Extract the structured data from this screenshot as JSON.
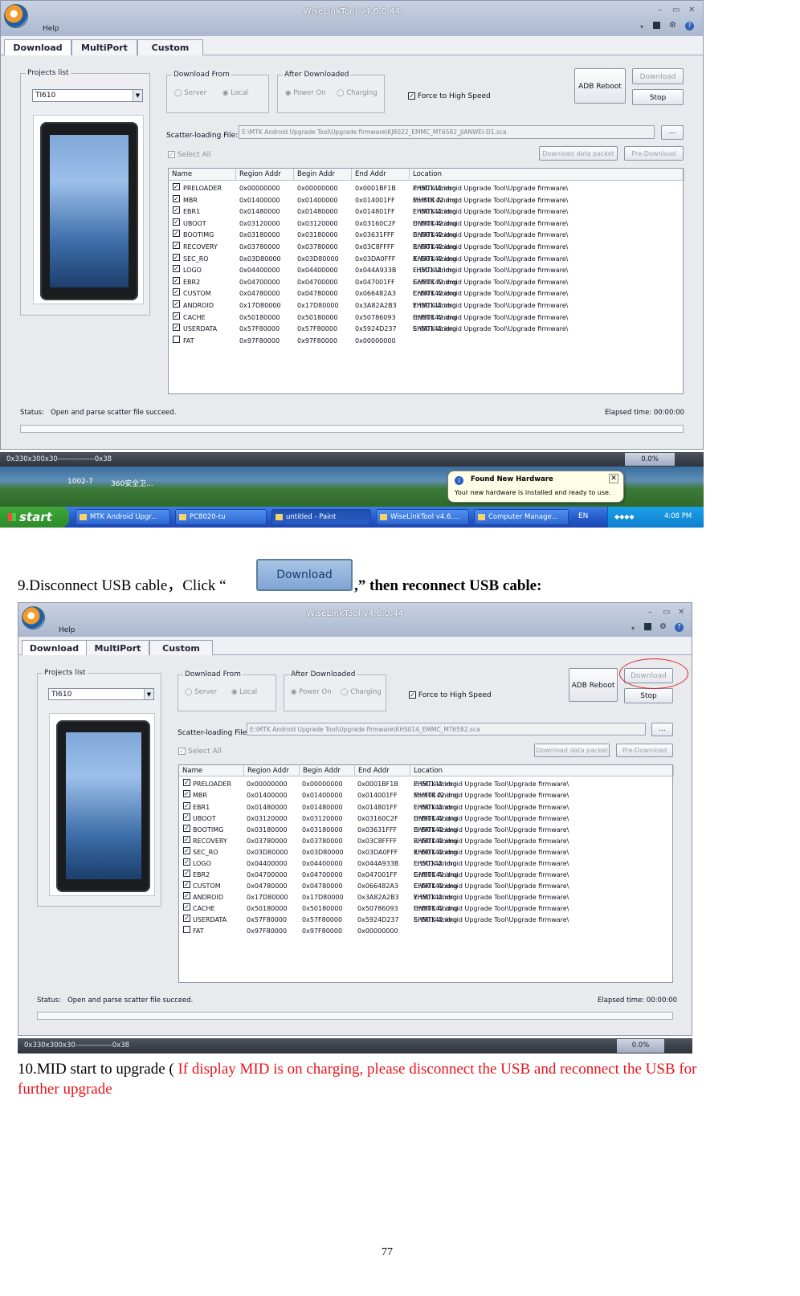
{
  "app": {
    "title": "WiseLinkTool v4.6.0.44",
    "menu_help": "Help",
    "tabs": [
      "Download",
      "MultiPort",
      "Custom"
    ],
    "projects_list_label": "Projects list",
    "project_selected": "TI610",
    "download_from": {
      "label": "Download From",
      "options": [
        "Server",
        "Local"
      ]
    },
    "after_downloaded": {
      "label": "After Downloaded",
      "options": [
        "Power On",
        "Charging"
      ]
    },
    "force_high_speed": "Force to High Speed",
    "buttons": {
      "adb_reboot": "ADB Reboot",
      "download": "Download",
      "stop": "Stop",
      "browse": "...",
      "download_data_packet": "Download data packet",
      "pre_download": "Pre-Download"
    },
    "scatter_label": "Scatter-loading File:",
    "select_all": "Select All",
    "columns": [
      "Name",
      "Region Addr",
      "Begin Addr",
      "End Addr",
      "Location"
    ],
    "rows": [
      {
        "checked": true,
        "name": "PRELOADER",
        "region": "0x00000000",
        "begin": "0x00000000",
        "end": "0x0001BF1B",
        "file": "PH50142.img"
      },
      {
        "checked": true,
        "name": "MBR",
        "region": "0x01400000",
        "begin": "0x01400000",
        "end": "0x014001FF",
        "file": "MH50142.img"
      },
      {
        "checked": true,
        "name": "EBR1",
        "region": "0x01480000",
        "begin": "0x01480000",
        "end": "0x014801FF",
        "file": "EH50142.img"
      },
      {
        "checked": true,
        "name": "UBOOT",
        "region": "0x03120000",
        "begin": "0x03120000",
        "end": "0x03160C2F",
        "file": "UH50142.img"
      },
      {
        "checked": true,
        "name": "BOOTIMG",
        "region": "0x03180000",
        "begin": "0x03180000",
        "end": "0x03631FFF",
        "file": "BH50142.img"
      },
      {
        "checked": true,
        "name": "RECOVERY",
        "region": "0x03780000",
        "begin": "0x03780000",
        "end": "0x03C8FFFF",
        "file": "RH50142.img"
      },
      {
        "checked": true,
        "name": "SEC_RO",
        "region": "0x03D80000",
        "begin": "0x03D80000",
        "end": "0x03DA0FFF",
        "file": "XH50142.img"
      },
      {
        "checked": true,
        "name": "LOGO",
        "region": "0x04400000",
        "begin": "0x04400000",
        "end": "0x044A933B",
        "file": "LH50142.img"
      },
      {
        "checked": true,
        "name": "EBR2",
        "region": "0x04700000",
        "begin": "0x04700000",
        "end": "0x047001FF",
        "file": "GH50142.img"
      },
      {
        "checked": true,
        "name": "CUSTOM",
        "region": "0x04780000",
        "begin": "0x04780000",
        "end": "0x066482A3",
        "file": "CH50142.img"
      },
      {
        "checked": true,
        "name": "ANDROID",
        "region": "0x17D80000",
        "begin": "0x17D80000",
        "end": "0x3A82A2B3",
        "file": "YH50142.img"
      },
      {
        "checked": true,
        "name": "CACHE",
        "region": "0x50180000",
        "begin": "0x50180000",
        "end": "0x50786093",
        "file": "HH50142.img"
      },
      {
        "checked": true,
        "name": "USERDATA",
        "region": "0x57F80000",
        "begin": "0x57F80000",
        "end": "0x5924D237",
        "file": "SH50142.img"
      },
      {
        "checked": false,
        "name": "FAT",
        "region": "0x97F80000",
        "begin": "0x97F80000",
        "end": "0x00000000",
        "file": ""
      }
    ],
    "location_prefix": "E:\\MTK Android Upgrade Tool\\Upgrade firmware\\",
    "status_label": "Status:",
    "status_text": "Open and parse scatter file succeed.",
    "elapsed_label": "Elapsed time:",
    "elapsed_value": "00:00:00",
    "bottom_info": "0x330x300x30---------------0x38",
    "percent": "0.0%"
  },
  "shot1": {
    "scatter_path": "E:\\MTK Android Upgrade Tool\\Upgrade firmware\\KJ8022_EMMC_MT6582_JIANWEI-D1.sca",
    "desktop_icons": [
      "1002-7",
      "360安全卫..."
    ],
    "balloon": {
      "title": "Found New Hardware",
      "text": "Your new hardware is installed and ready to use."
    },
    "taskbar": {
      "start": "start",
      "items": [
        "MTK Android Upgr...",
        "PC8020-tu",
        "untitled - Paint",
        "WiseLinkTool v4.6....",
        "Computer Manage..."
      ],
      "lang": "EN",
      "time": "4:08 PM"
    }
  },
  "shot2": {
    "scatter_path": "E:\\MTK Android Upgrade Tool\\Upgrade firmware\\KHS014_EMMC_MT6582.sca"
  },
  "doc": {
    "step9_prefix": "9.Disconnect USB cable，Click “",
    "step9_button": "Download",
    "step9_suffix": ",” then reconnect USB cable:",
    "step10_prefix": "10.MID start to upgrade ( ",
    "step10_red": "If display MID is on charging, please disconnect the USB and reconnect the USB for",
    "step10_red2": "further upgrade",
    "page_number": "77"
  },
  "colors": {
    "accent_red": "#e8141b",
    "window_bg": "#e9eaee",
    "title_blue": "#aab8cf"
  }
}
